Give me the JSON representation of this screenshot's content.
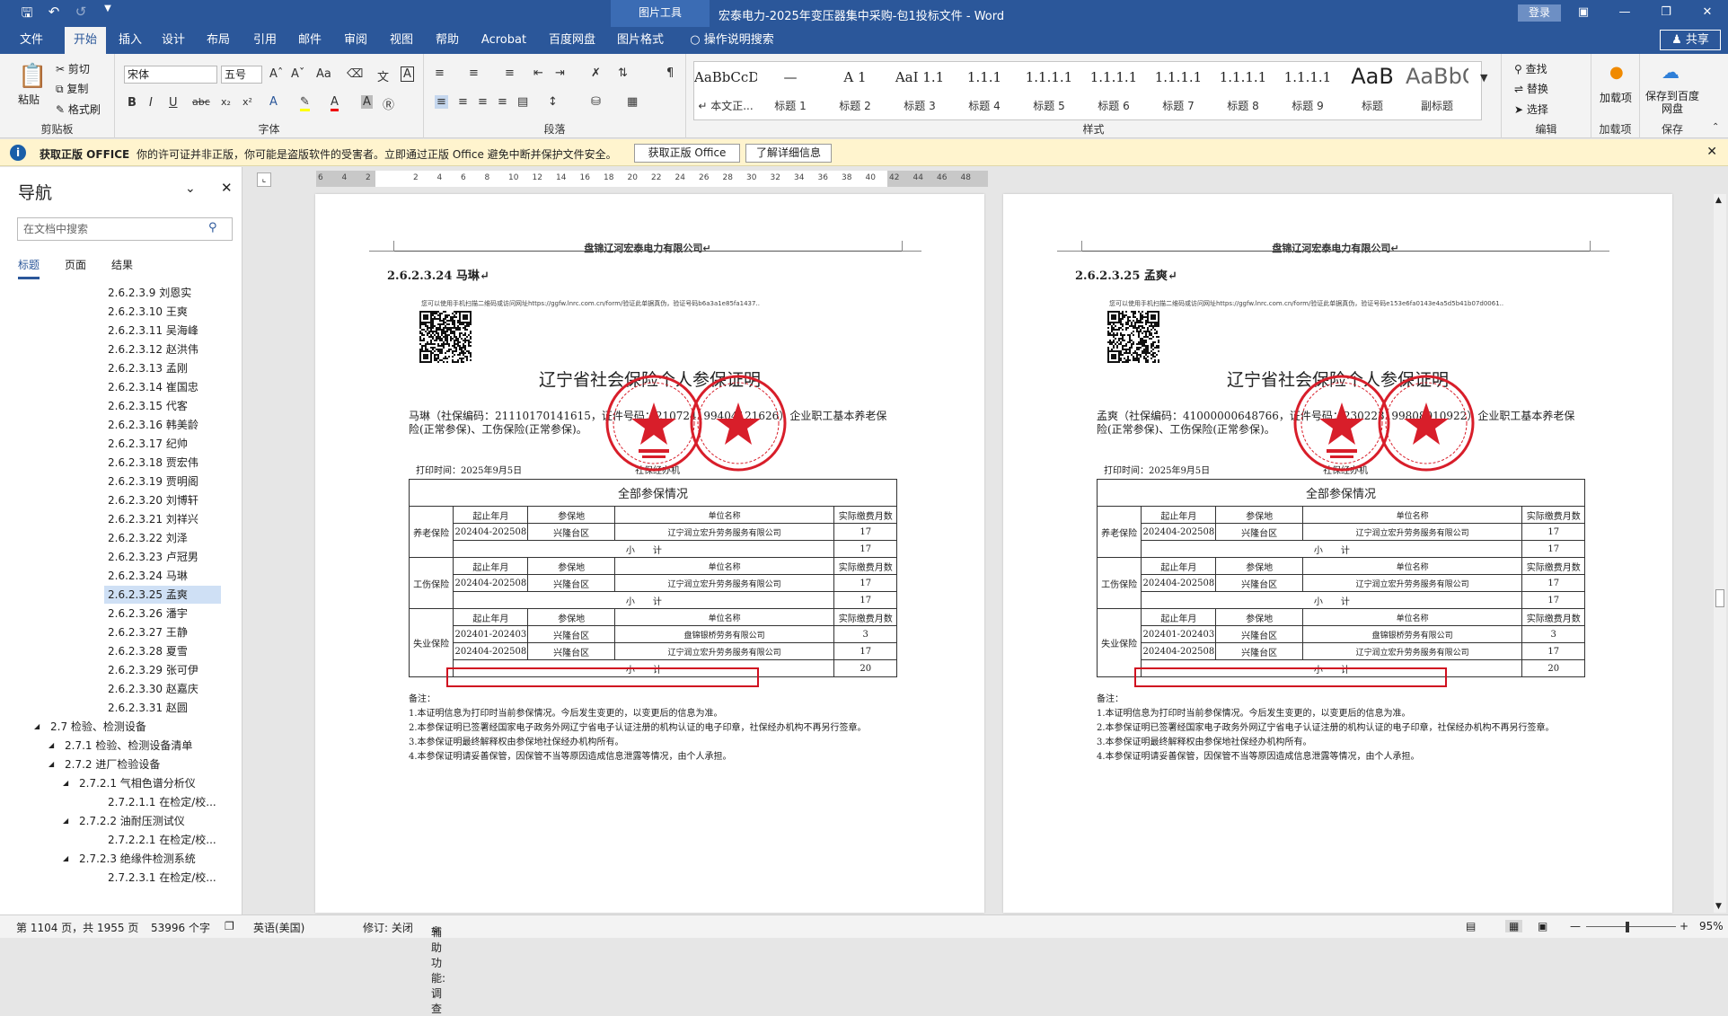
{
  "title": {
    "doc": "宏泰电力-2025年变压器集中采购-包1投标文件 - Word",
    "context_tab": "图片工具",
    "login": "登录",
    "share": "共享"
  },
  "tabs": [
    "文件",
    "开始",
    "插入",
    "设计",
    "布局",
    "引用",
    "邮件",
    "审阅",
    "视图",
    "帮助",
    "Acrobat",
    "百度网盘",
    "图片格式",
    "操作说明搜索"
  ],
  "ribbon": {
    "clipboard": {
      "paste": "粘贴",
      "cut": "剪切",
      "copy": "复制",
      "format_painter": "格式刷",
      "label": "剪贴板"
    },
    "font": {
      "name": "宋体",
      "size": "五号",
      "label": "字体"
    },
    "paragraph": {
      "label": "段落"
    },
    "styles": {
      "label": "样式",
      "items": [
        {
          "preview": "AaBbCcDdI",
          "name": "↵ 本文正..."
        },
        {
          "preview": "—",
          "name": "标题 1"
        },
        {
          "preview": "A 1",
          "name": "标题 2"
        },
        {
          "preview": "AaI 1.1",
          "name": "标题 3"
        },
        {
          "preview": "1.1.1",
          "name": "标题 4"
        },
        {
          "preview": "1.1.1.1",
          "name": "标题 5"
        },
        {
          "preview": "1.1.1.1",
          "name": "标题 6"
        },
        {
          "preview": "1.1.1.1",
          "name": "标题 7"
        },
        {
          "preview": "1.1.1.1",
          "name": "标题 8"
        },
        {
          "preview": "1.1.1.1",
          "name": "标题 9"
        },
        {
          "preview": "AaB",
          "name": "标题"
        },
        {
          "preview": "AaBbC",
          "name": "副标题"
        }
      ]
    },
    "editing": {
      "find": "查找",
      "replace": "替换",
      "select": "选择",
      "label": "编辑"
    },
    "addins": {
      "name": "加载项",
      "label": "加载项"
    },
    "save": {
      "name": "保存到百度网盘",
      "label": "保存"
    }
  },
  "infobar": {
    "title": "获取正版 OFFICE",
    "message": "你的许可证并非正版，你可能是盗版软件的受害者。立即通过正版 Office 避免中断并保护文件安全。",
    "btn1": "获取正版 Office",
    "btn2": "了解详细信息"
  },
  "nav": {
    "title": "导航",
    "search_placeholder": "在文档中搜索",
    "tabs": [
      "标题",
      "页面",
      "结果"
    ],
    "items": [
      {
        "text": "2.6.2.3.9 刘恩实",
        "level": 5
      },
      {
        "text": "2.6.2.3.10 王爽",
        "level": 5
      },
      {
        "text": "2.6.2.3.11 吴海峰",
        "level": 5
      },
      {
        "text": "2.6.2.3.12 赵洪伟",
        "level": 5
      },
      {
        "text": "2.6.2.3.13 孟刚",
        "level": 5
      },
      {
        "text": "2.6.2.3.14 崔国忠",
        "level": 5
      },
      {
        "text": "2.6.2.3.15 代客",
        "level": 5
      },
      {
        "text": "2.6.2.3.16 韩美龄",
        "level": 5
      },
      {
        "text": "2.6.2.3.17 纪帅",
        "level": 5
      },
      {
        "text": "2.6.2.3.18 贾宏伟",
        "level": 5
      },
      {
        "text": "2.6.2.3.19 贾明阁",
        "level": 5
      },
      {
        "text": "2.6.2.3.20 刘博轩",
        "level": 5
      },
      {
        "text": "2.6.2.3.21 刘祥兴",
        "level": 5
      },
      {
        "text": "2.6.2.3.22 刘泽",
        "level": 5
      },
      {
        "text": "2.6.2.3.23 卢冠男",
        "level": 5
      },
      {
        "text": "2.6.2.3.24 马琳",
        "level": 5
      },
      {
        "text": "2.6.2.3.25 孟爽",
        "level": 5
      },
      {
        "text": "2.6.2.3.26 潘宇",
        "level": 5
      },
      {
        "text": "2.6.2.3.27 王静",
        "level": 5
      },
      {
        "text": "2.6.2.3.28 夏雪",
        "level": 5
      },
      {
        "text": "2.6.2.3.29 张可伊",
        "level": 5
      },
      {
        "text": "2.6.2.3.30 赵嘉庆",
        "level": 5
      },
      {
        "text": "2.6.2.3.31 赵圆",
        "level": 5
      },
      {
        "text": "2.7 检验、检测设备",
        "level": 1
      },
      {
        "text": "2.7.1 检验、检测设备清单",
        "level": 2
      },
      {
        "text": "2.7.2 进厂检验设备",
        "level": 2
      },
      {
        "text": "2.7.2.1 气相色谱分析仪",
        "level": 3
      },
      {
        "text": "2.7.2.1.1 在检定/校...",
        "level": 5
      },
      {
        "text": "2.7.2.2 油耐压测试仪",
        "level": 3
      },
      {
        "text": "2.7.2.2.1 在检定/校...",
        "level": 5
      },
      {
        "text": "2.7.2.3 绝缘件检测系统",
        "level": 3
      },
      {
        "text": "2.7.2.3.1 在检定/校...",
        "level": 5
      }
    ]
  },
  "ruler_ticks": [
    "6",
    "4",
    "2",
    "",
    "2",
    "4",
    "6",
    "8",
    "10",
    "12",
    "14",
    "16",
    "18",
    "20",
    "22",
    "24",
    "26",
    "28",
    "30",
    "32",
    "34",
    "36",
    "38",
    "40",
    "42",
    "44",
    "46",
    "48"
  ],
  "pages": [
    {
      "header": "盘锦辽河宏泰电力有限公司↵",
      "heading": "2.6.2.3.24 马琳↵",
      "tiny": "您可以使用手机扫描二维码或访问网址https://ggfw.lnrc.com.cn/form/验证此单据真伪，验证号码b6a3a1e85fa1437..",
      "cert_title": "辽宁省社会保险个人参保证明",
      "para": "马琳（社保编码：21110170141615，证件号码：210724199404121626）企业职工基本养老保险(正常参保)、工伤保险(正常参保)。",
      "print_time": "打印时间：2025年9月5日",
      "agency": "社保经办机",
      "t_all": "全部参保情况",
      "rows": [
        [
          "养老保险",
          "起止年月",
          "参保地",
          "单位名称",
          "实际缴费月数"
        ],
        [
          "",
          "202404-202508",
          "兴隆台区",
          "辽宁润立宏升劳务服务有限公司",
          "17"
        ],
        [
          "",
          "小　　计",
          "",
          "",
          "17"
        ],
        [
          "工伤保险",
          "起止年月",
          "参保地",
          "单位名称",
          "实际缴费月数"
        ],
        [
          "",
          "202404-202508",
          "兴隆台区",
          "辽宁润立宏升劳务服务有限公司",
          "17"
        ],
        [
          "",
          "小　　计",
          "",
          "",
          "17"
        ],
        [
          "失业保险",
          "起止年月",
          "参保地",
          "单位名称",
          "实际缴费月数"
        ],
        [
          "",
          "202401-202403",
          "兴隆台区",
          "盘锦银桥劳务有限公司",
          "3"
        ],
        [
          "",
          "202404-202508",
          "兴隆台区",
          "辽宁润立宏升劳务服务有限公司",
          "17"
        ],
        [
          "",
          "小　　计",
          "",
          "",
          "20"
        ]
      ],
      "notes": [
        "备注：",
        "1.本证明信息为打印时当前参保情况。今后发生变更的，以变更后的信息为准。",
        "2.本参保证明已签署经国家电子政务外网辽宁省电子认证注册的机构认证的电子印章，社保经办机构不再另行签章。",
        "3.本参保证明最终解释权由参保地社保经办机构所有。",
        "4.本参保证明请妥善保管，因保管不当等原因造成信息泄露等情况，由个人承担。"
      ]
    },
    {
      "header": "盘锦辽河宏泰电力有限公司↵",
      "heading": "2.6.2.3.25 孟爽↵",
      "tiny": "您可以使用手机扫描二维码或访问网址https://ggfw.lnrc.com.cn/form/验证此单据真伪，验证号码e153e6fa0143e4a5d5b41b07d0061..",
      "cert_title": "辽宁省社会保险个人参保证明",
      "para": "孟爽（社保编码：41000000648766，证件号码：230223199808010922）企业职工基本养老保险(正常参保)、工伤保险(正常参保)。",
      "print_time": "打印时间：2025年9月5日",
      "agency": "社保经办机",
      "t_all": "全部参保情况",
      "rows": [
        [
          "养老保险",
          "起止年月",
          "参保地",
          "单位名称",
          "实际缴费月数"
        ],
        [
          "",
          "202404-202508",
          "兴隆台区",
          "辽宁润立宏升劳务服务有限公司",
          "17"
        ],
        [
          "",
          "小　　计",
          "",
          "",
          "17"
        ],
        [
          "工伤保险",
          "起止年月",
          "参保地",
          "单位名称",
          "实际缴费月数"
        ],
        [
          "",
          "202404-202508",
          "兴隆台区",
          "辽宁润立宏升劳务服务有限公司",
          "17"
        ],
        [
          "",
          "小　　计",
          "",
          "",
          "17"
        ],
        [
          "失业保险",
          "起止年月",
          "参保地",
          "单位名称",
          "实际缴费月数"
        ],
        [
          "",
          "202401-202403",
          "兴隆台区",
          "盘锦银桥劳务有限公司",
          "3"
        ],
        [
          "",
          "202404-202508",
          "兴隆台区",
          "辽宁润立宏升劳务服务有限公司",
          "17"
        ],
        [
          "",
          "小　　计",
          "",
          "",
          "20"
        ]
      ],
      "notes": [
        "备注：",
        "1.本证明信息为打印时当前参保情况。今后发生变更的，以变更后的信息为准。",
        "2.本参保证明已签署经国家电子政务外网辽宁省电子认证注册的机构认证的电子印章，社保经办机构不再另行签章。",
        "3.本参保证明最终解释权由参保地社保经办机构所有。",
        "4.本参保证明请妥善保管，因保管不当等原因造成信息泄露等情况，由个人承担。"
      ]
    }
  ],
  "status": {
    "page": "第 1104 页，共 1955 页",
    "words": "53996 个字",
    "lang": "英语(美国)",
    "track": "修订: 关闭",
    "access": "辅助功能: 调查",
    "zoom": "95%"
  },
  "colors": {
    "accent": "#2b579a",
    "seal": "#d81e2a",
    "highlight_box": "#d01020"
  }
}
